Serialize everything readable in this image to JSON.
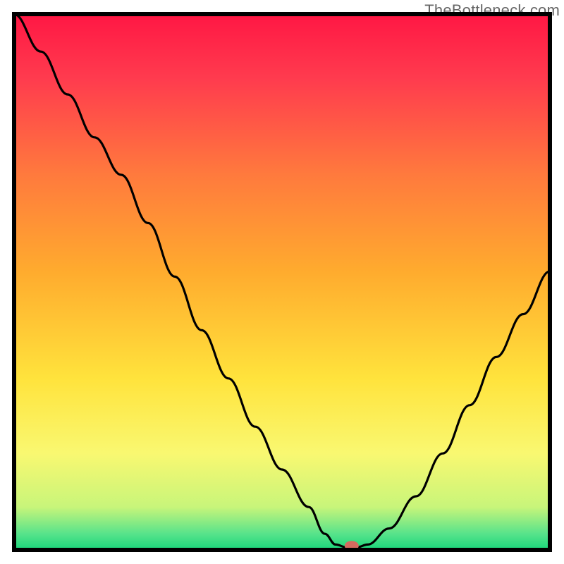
{
  "watermark": "TheBottleneck.com",
  "chart_data": {
    "type": "line",
    "title": "",
    "xlabel": "",
    "ylabel": "",
    "xlim": [
      0,
      100
    ],
    "ylim": [
      0,
      100
    ],
    "grid": false,
    "comment": "Axes are unlabeled in the image; x is normalized 0–100 left→right, y is bottleneck percentage 0–100 bottom→top. Values estimated from pixel positions.",
    "series": [
      {
        "name": "bottleneck-curve",
        "x": [
          0,
          5,
          10,
          15,
          20,
          25,
          30,
          35,
          40,
          45,
          50,
          55,
          58,
          60,
          62,
          64,
          66,
          70,
          75,
          80,
          85,
          90,
          95,
          100
        ],
        "y": [
          100,
          93,
          85,
          77,
          70,
          61,
          51,
          41,
          32,
          23,
          15,
          8,
          3,
          1,
          0.5,
          0.5,
          1,
          4,
          10,
          18,
          27,
          36,
          44,
          52
        ]
      }
    ],
    "optimal_point": {
      "x": 63,
      "y": 0.5
    },
    "colors": {
      "curve": "#000000",
      "marker": "#d46a5f",
      "gradient_top": "#ff1744",
      "gradient_bottom": "#19d67a"
    }
  }
}
